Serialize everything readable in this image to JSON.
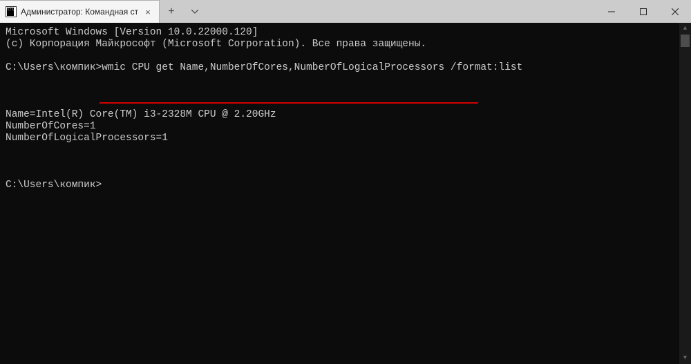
{
  "titlebar": {
    "tab_title": "Администратор: Командная ст",
    "new_tab_label": "+",
    "close_tab_label": "×"
  },
  "terminal": {
    "line1": "Microsoft Windows [Version 10.0.22000.120]",
    "line2": "(c) Корпорация Майкрософт (Microsoft Corporation). Все права защищены.",
    "prompt1_path": "C:\\Users\\компик>",
    "command1": "wmic CPU get Name,NumberOfCores,NumberOfLogicalProcessors /format:list",
    "output_name": "Name=Intel(R) Core(TM) i3-2328M CPU @ 2.20GHz",
    "output_cores": "NumberOfCores=1",
    "output_logical": "NumberOfLogicalProcessors=1",
    "prompt2_path": "C:\\Users\\компик>"
  }
}
